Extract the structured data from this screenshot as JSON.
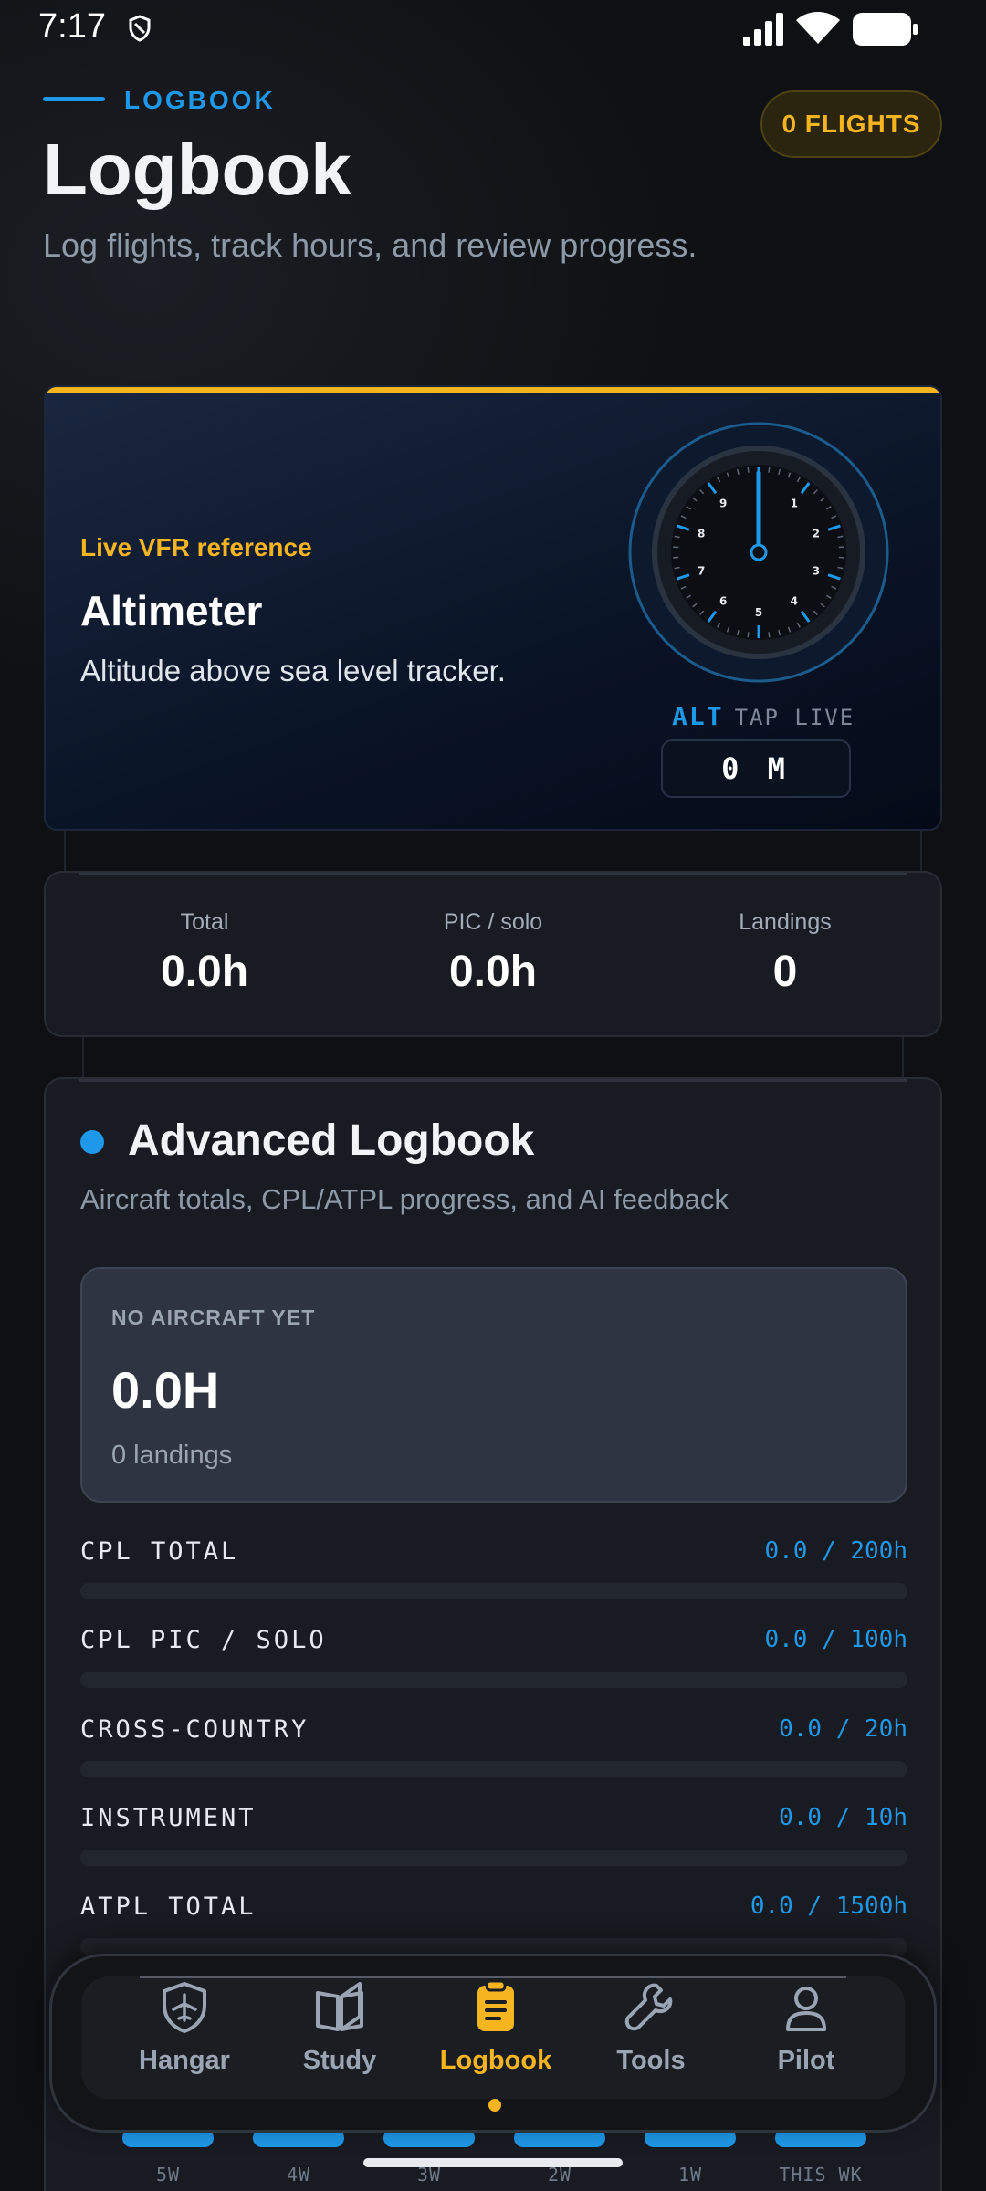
{
  "status_bar": {
    "time": "7:17"
  },
  "header": {
    "eyebrow": "LOGBOOK",
    "title": "Logbook",
    "subtitle": "Log flights, track hours, and review progress.",
    "flights_badge": "0 FLIGHTS"
  },
  "altimeter_card": {
    "tag": "Live VFR reference",
    "title": "Altimeter",
    "description": "Altitude above sea level tracker.",
    "gauge_label": "ALT",
    "gauge_hint": "TAP LIVE",
    "readout": "0 M",
    "dial_numbers": [
      "1",
      "2",
      "3",
      "4",
      "5",
      "6",
      "7",
      "8",
      "9"
    ]
  },
  "stats": [
    {
      "label": "Total",
      "value": "0.0h"
    },
    {
      "label": "PIC / solo",
      "value": "0.0h"
    },
    {
      "label": "Landings",
      "value": "0"
    }
  ],
  "advanced": {
    "title": "Advanced Logbook",
    "subtitle": "Aircraft totals, CPL/ATPL progress, and AI feedback",
    "aircraft": {
      "label": "NO AIRCRAFT YET",
      "hours": "0.0H",
      "landings": "0 landings"
    },
    "progress": [
      {
        "label": "CPL TOTAL",
        "value": "0.0 / 200h",
        "fraction": 0
      },
      {
        "label": "CPL PIC / SOLO",
        "value": "0.0 / 100h",
        "fraction": 0
      },
      {
        "label": "CROSS-COUNTRY",
        "value": "0.0 / 20h",
        "fraction": 0
      },
      {
        "label": "INSTRUMENT",
        "value": "0.0 / 10h",
        "fraction": 0
      },
      {
        "label": "ATPL TOTAL",
        "value": "0.0 / 1500h",
        "fraction": 0
      }
    ],
    "weeks": [
      "5W",
      "4W",
      "3W",
      "2W",
      "1W",
      "THIS WK"
    ]
  },
  "nav": {
    "items": [
      {
        "label": "Hangar",
        "icon": "airplane-shield-icon"
      },
      {
        "label": "Study",
        "icon": "book-icon"
      },
      {
        "label": "Logbook",
        "icon": "clipboard-icon",
        "active": true
      },
      {
        "label": "Tools",
        "icon": "wrench-icon"
      },
      {
        "label": "Pilot",
        "icon": "person-icon"
      }
    ]
  },
  "colors": {
    "accent_blue": "#1e98e8",
    "accent_yellow": "#f6b41e",
    "background": "#0e1013"
  }
}
